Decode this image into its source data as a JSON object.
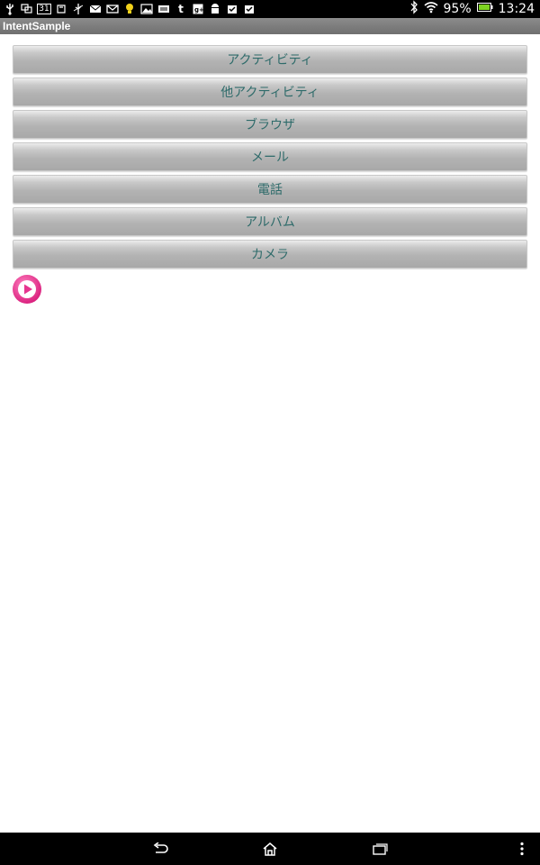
{
  "status_bar": {
    "left_icons": [
      "usb-icon",
      "notification-icon",
      "calendar-icon",
      "sd-card-icon",
      "usb-debug-icon",
      "email-icon",
      "gmail-icon",
      "lightbulb-icon",
      "gallery-icon",
      "keyboard-icon",
      "tumblr-icon",
      "google-plus-icon",
      "android-icon",
      "checkmark-icon",
      "checkmark-icon"
    ],
    "calendar_day": "31",
    "battery_percent": "95%",
    "time": "13:24"
  },
  "app": {
    "title": "IntentSample"
  },
  "buttons": [
    {
      "label": "アクティビティ"
    },
    {
      "label": "他アクティビティ"
    },
    {
      "label": "ブラウザ"
    },
    {
      "label": "メール"
    },
    {
      "label": "電話"
    },
    {
      "label": "アルバム"
    },
    {
      "label": "カメラ"
    }
  ],
  "colors": {
    "button_text": "#2e6b6a",
    "play_button": "#e6358f",
    "battery": "#7dd321"
  },
  "nav_bar": {
    "icons": [
      "back-icon",
      "home-icon",
      "recent-apps-icon",
      "menu-overflow-icon"
    ]
  }
}
